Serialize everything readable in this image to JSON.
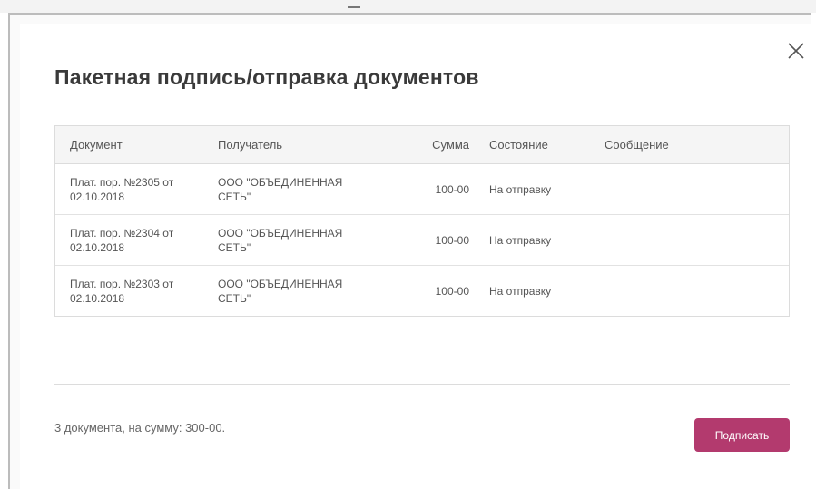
{
  "modal": {
    "title": "Пакетная подпись/отправка документов",
    "close_icon": "close-icon"
  },
  "table": {
    "headers": {
      "document": "Документ",
      "recipient": "Получатель",
      "amount": "Сумма",
      "status": "Состояние",
      "message": "Сообщение"
    },
    "rows": [
      {
        "document_line1": "Плат. пор. №2305 от",
        "document_line2": "02.10.2018",
        "recipient_line1": "ООО \"ОБЪЕДИНЕННАЯ",
        "recipient_line2": "СЕТЬ\"",
        "amount": "100-00",
        "status": "На отправку",
        "message": ""
      },
      {
        "document_line1": "Плат. пор. №2304 от",
        "document_line2": "02.10.2018",
        "recipient_line1": "ООО \"ОБЪЕДИНЕННАЯ",
        "recipient_line2": "СЕТЬ\"",
        "amount": "100-00",
        "status": "На отправку",
        "message": ""
      },
      {
        "document_line1": "Плат. пор. №2303 от",
        "document_line2": "02.10.2018",
        "recipient_line1": "ООО \"ОБЪЕДИНЕННАЯ",
        "recipient_line2": "СЕТЬ\"",
        "amount": "100-00",
        "status": "На отправку",
        "message": ""
      }
    ]
  },
  "footer": {
    "summary": "3 документа, на сумму: 300-00.",
    "sign_label": "Подписать"
  },
  "colors": {
    "accent": "#b33a6e",
    "title": "#3a3a3a",
    "header_bg": "#f5f5f5"
  }
}
